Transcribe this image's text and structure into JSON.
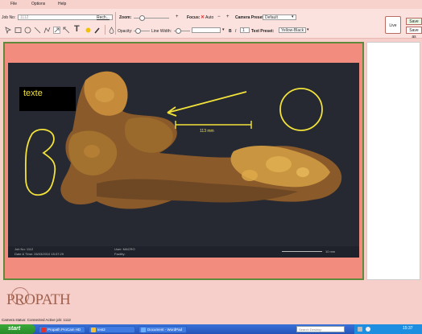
{
  "menu": {
    "items": [
      "File",
      "Options",
      "Help"
    ]
  },
  "toolbar": {
    "job_label": "Job No:",
    "job_value": "1112",
    "job_link": "Rech...",
    "zoom_label": "Zoom:",
    "focus_label": "Focus:",
    "focus_auto": "Auto",
    "camera_preset_label": "Camera Preset:",
    "camera_preset_value": "Default",
    "opacity_label": "Opacity:",
    "line_width_label": "Line Width:",
    "bold_label": "B",
    "italic_label": "I",
    "font_size_value": "1",
    "text_preset_label": "Text Preset:",
    "text_preset_value": "Yellow-Black",
    "live_button": "Live",
    "save_button": "Save",
    "save_as_button": "Save as"
  },
  "image": {
    "annotation_text": "texte",
    "scale_label": "113 mm",
    "caption": {
      "job": "Job No: 1112",
      "datetime": "Date & Time: 26/03/2010 15:37:29",
      "user": "User: MACRO",
      "facility": "Facility:",
      "scale": "10 mm"
    }
  },
  "logo": {
    "text": "PROPATH"
  },
  "status": {
    "text": "Camera status: Connected   Active job: 1112"
  },
  "taskbar": {
    "start": "start",
    "tasks": [
      "Propath ProCam HD",
      "test2",
      "Document - WordPad"
    ],
    "search_placeholder": "Search Desktop",
    "clock": "15:37"
  },
  "colors": {
    "app_bg": "#f7cfca",
    "frame_border": "#5f8a3c",
    "frame_fill": "#f28c7e",
    "annotation": "#f2e23a",
    "taskbar": "#2a5bc4"
  }
}
